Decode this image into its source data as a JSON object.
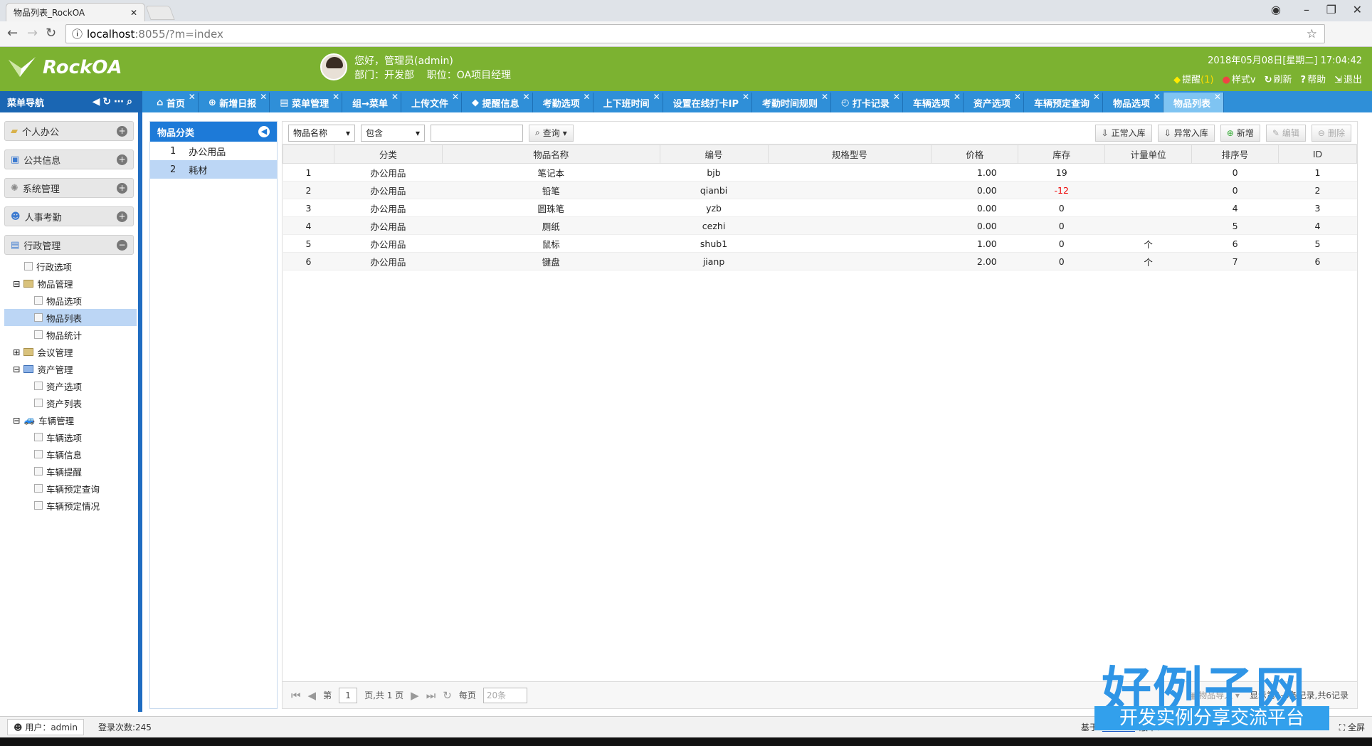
{
  "browser": {
    "tab_title": "物品列表_RockOA",
    "url_host": "localhost",
    "url_path": ":8055/?m=index"
  },
  "header": {
    "logo": "RockOA",
    "greeting": "您好，管理员(admin)",
    "dept_line": "部门：开发部    职位：OA项目经理",
    "datetime": "2018年05月08日[星期二] 17:04:42",
    "links": {
      "remind": "提醒",
      "remind_count": "(1)",
      "style": "样式v",
      "refresh": "刷新",
      "help": "帮助",
      "logout": "退出"
    }
  },
  "menu_title": "菜单导航",
  "tabs": [
    {
      "label": "首页"
    },
    {
      "label": "新增日报"
    },
    {
      "label": "菜单管理"
    },
    {
      "label": "组→菜单"
    },
    {
      "label": "上传文件"
    },
    {
      "label": "提醒信息"
    },
    {
      "label": "考勤选项"
    },
    {
      "label": "上下班时间"
    },
    {
      "label": "设置在线打卡IP"
    },
    {
      "label": "考勤时间规则"
    },
    {
      "label": "打卡记录"
    },
    {
      "label": "车辆选项"
    },
    {
      "label": "资产选项"
    },
    {
      "label": "车辆预定查询"
    },
    {
      "label": "物品选项"
    },
    {
      "label": "物品列表"
    }
  ],
  "sidebar": {
    "sections": [
      "个人办公",
      "公共信息",
      "系统管理",
      "人事考勤",
      "行政管理"
    ],
    "tree": {
      "n1": "行政选项",
      "n2": "物品管理",
      "n3": "物品选项",
      "n4": "物品列表",
      "n5": "物品统计",
      "n6": "会议管理",
      "n7": "资产管理",
      "n8": "资产选项",
      "n9": "资产列表",
      "n10": "车辆管理",
      "n11": "车辆选项",
      "n12": "车辆信息",
      "n13": "车辆提醒",
      "n14": "车辆预定查询",
      "n15": "车辆预定情况"
    }
  },
  "category": {
    "title": "物品分类",
    "items": [
      {
        "no": "1",
        "name": "办公用品"
      },
      {
        "no": "2",
        "name": "耗材"
      }
    ]
  },
  "toolbar": {
    "field": "物品名称",
    "op": "包含",
    "query": "查询",
    "in_normal": "正常入库",
    "in_abnormal": "异常入库",
    "add": "新增",
    "edit": "编辑",
    "delete": "删除"
  },
  "table": {
    "headers": [
      "分类",
      "物品名称",
      "编号",
      "规格型号",
      "价格",
      "库存",
      "计量单位",
      "排序号",
      "ID"
    ],
    "rows": [
      [
        "1",
        "办公用品",
        "笔记本",
        "bjb",
        "",
        "1.00",
        "19",
        "",
        "0",
        "1"
      ],
      [
        "2",
        "办公用品",
        "铅笔",
        "qianbi",
        "",
        "0.00",
        "-12",
        "",
        "0",
        "2"
      ],
      [
        "3",
        "办公用品",
        "圆珠笔",
        "yzb",
        "",
        "0.00",
        "0",
        "",
        "4",
        "3"
      ],
      [
        "4",
        "办公用品",
        "厕纸",
        "cezhi",
        "",
        "0.00",
        "0",
        "",
        "5",
        "4"
      ],
      [
        "5",
        "办公用品",
        "鼠标",
        "shub1",
        "",
        "1.00",
        "0",
        "个",
        "6",
        "5"
      ],
      [
        "6",
        "办公用品",
        "键盘",
        "jianp",
        "",
        "2.00",
        "0",
        "个",
        "7",
        "6"
      ]
    ]
  },
  "pager": {
    "page_label": "第",
    "page": "1",
    "page_total": "页,共 1 页",
    "per_page": "每页",
    "per_page_val": "20条",
    "import": "物品导入",
    "summary": "显示第1-6条记录,共6记录"
  },
  "status": {
    "user": "用户：admin",
    "logins": "登录次数:245",
    "credit_pre": "基于",
    "credit_link": "RockOA",
    "credit_post": "版本：V2.3.2",
    "fullscreen": "全屏"
  },
  "watermark": {
    "big": "好例子网",
    "sub": "开发实例分享交流平台"
  }
}
